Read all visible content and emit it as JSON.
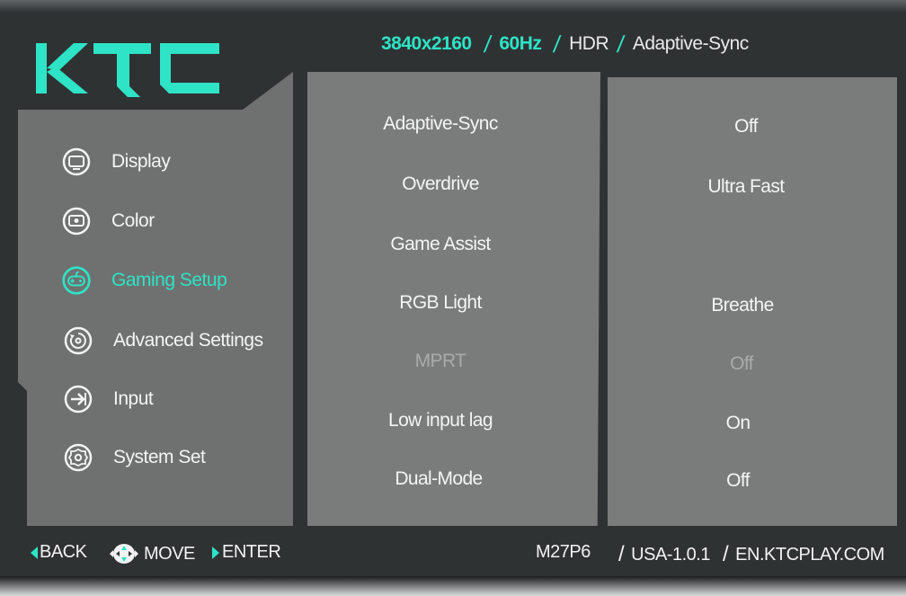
{
  "brand": {
    "logo_text": "KTC"
  },
  "status_bar": {
    "resolution": "3840x2160",
    "refresh": "60Hz",
    "hdr": "HDR",
    "sync": "Adaptive-Sync"
  },
  "menu": {
    "items": [
      {
        "label": "Display",
        "icon": "display-icon",
        "active": false
      },
      {
        "label": "Color",
        "icon": "color-icon",
        "active": false
      },
      {
        "label": "Gaming Setup",
        "icon": "gamepad-icon",
        "active": true
      },
      {
        "label": "Advanced Settings",
        "icon": "advanced-settings-icon",
        "active": false
      },
      {
        "label": "Input",
        "icon": "input-icon",
        "active": false
      },
      {
        "label": "System Set",
        "icon": "gear-icon",
        "active": false
      }
    ]
  },
  "settings": [
    {
      "label": "Adaptive-Sync",
      "value": "Off",
      "disabled": false
    },
    {
      "label": "Overdrive",
      "value": "Ultra Fast",
      "disabled": false
    },
    {
      "label": "Game Assist",
      "value": "",
      "disabled": false
    },
    {
      "label": "RGB Light",
      "value": "Breathe",
      "disabled": false
    },
    {
      "label": "MPRT",
      "value": "Off",
      "disabled": true
    },
    {
      "label": "Low input lag",
      "value": "On",
      "disabled": false
    },
    {
      "label": "Dual-Mode",
      "value": "Off",
      "disabled": false
    }
  ],
  "footer": {
    "back": "BACK",
    "move": "MOVE",
    "enter": "ENTER",
    "model": "M27P6",
    "firmware": "USA-1.0.1",
    "website": "EN.KTCPLAY.COM"
  },
  "colors": {
    "accent": "#2ee3c6",
    "panel": "#7a7c7b",
    "background": "#2f3233",
    "nav_panel": "#6f7170"
  }
}
